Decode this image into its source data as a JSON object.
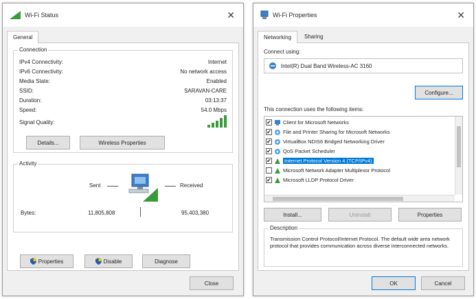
{
  "status": {
    "title": "Wi-Fi Status",
    "tab_general": "General",
    "connection_label": "Connection",
    "rows": [
      {
        "label": "IPv4 Connectivity:",
        "value": "Internet"
      },
      {
        "label": "IPv6 Connectivity:",
        "value": "No network access"
      },
      {
        "label": "Media State:",
        "value": "Enabled"
      },
      {
        "label": "SSID:",
        "value": "SARAVAN-CARE"
      },
      {
        "label": "Duration:",
        "value": "03:13:37"
      },
      {
        "label": "Speed:",
        "value": "54.0 Mbps"
      }
    ],
    "signal_label": "Signal Quality:",
    "details_button": "Details...",
    "wireless_props_button": "Wireless Properties",
    "activity_label": "Activity",
    "sent_label": "Sent",
    "received_label": "Received",
    "bytes_label": "Bytes:",
    "bytes_sent": "11,805,808",
    "bytes_received": "95,403,380",
    "properties_button": "Properties",
    "disable_button": "Disable",
    "diagnose_button": "Diagnose",
    "close_button": "Close"
  },
  "properties": {
    "title": "Wi-Fi Properties",
    "tab_networking": "Networking",
    "tab_sharing": "Sharing",
    "connect_using_label": "Connect using:",
    "adapter_name": "Intel(R) Dual Band Wireless-AC 3160",
    "configure_button": "Configure...",
    "items_label": "This connection uses the following items:",
    "items": [
      {
        "label": "Client for Microsoft Networks",
        "checked": true,
        "icon": "network-client-icon"
      },
      {
        "label": "File and Printer Sharing for Microsoft Networks",
        "checked": true,
        "icon": "network-service-icon"
      },
      {
        "label": "VirtualBox NDIS6 Bridged Networking Driver",
        "checked": true,
        "icon": "network-service-icon"
      },
      {
        "label": "QoS Packet Scheduler",
        "checked": true,
        "icon": "network-service-icon"
      },
      {
        "label": "Internet Protocol Version 4 (TCP/IPv4)",
        "checked": true,
        "icon": "protocol-icon",
        "selected": true
      },
      {
        "label": "Microsoft Network Adapter Multiplexor Protocol",
        "checked": false,
        "icon": "protocol-icon"
      },
      {
        "label": "Microsoft LLDP Protocol Driver",
        "checked": true,
        "icon": "protocol-icon"
      }
    ],
    "install_button": "Install...",
    "uninstall_button": "Uninstall",
    "properties_button": "Properties",
    "description_label": "Description",
    "description_text": "Transmission Control Protocol/Internet Protocol. The default wide area network protocol that provides communication across diverse interconnected networks.",
    "ok_button": "OK",
    "cancel_button": "Cancel"
  },
  "colors": {
    "accent": "#0078d7",
    "signal": "#3a9a3a"
  }
}
